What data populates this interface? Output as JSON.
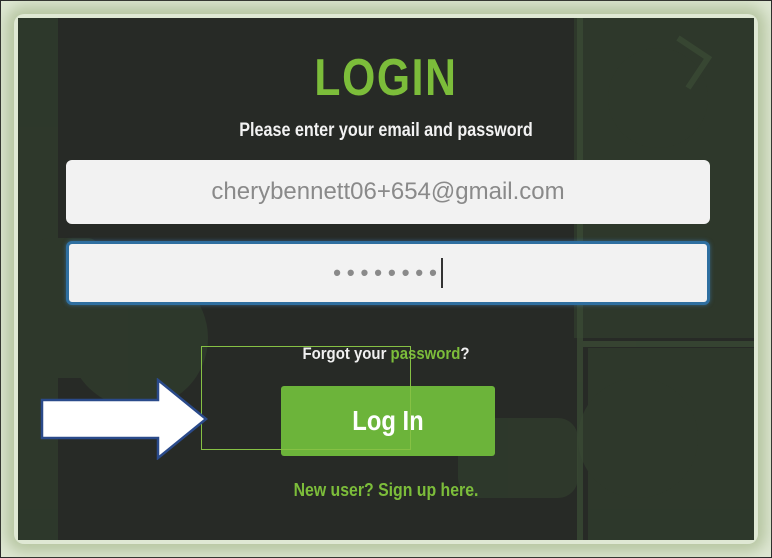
{
  "login": {
    "title": "LOGIN",
    "subtitle": "Please enter your email and password",
    "email_value": "cherybennett06+654@gmail.com",
    "password_mask": "••••••••",
    "forgot_prefix": "Forgot your ",
    "forgot_link": "password",
    "forgot_suffix": "?",
    "login_button": "Log In",
    "signup_link": "New user? Sign up here."
  },
  "colors": {
    "accent_green": "#7cbd3a",
    "button_green": "#6cb43a",
    "panel_dark": "#272a26",
    "focus_blue": "#2f6fa0"
  },
  "annotations": {
    "arrow_icon": "right-arrow-icon",
    "highlight_box": "focus-rectangle"
  }
}
